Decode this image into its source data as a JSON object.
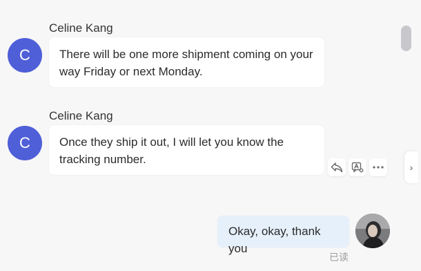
{
  "messages": [
    {
      "sender": "Celine Kang",
      "avatar_letter": "C",
      "text": "There will be one more shipment coming on your way Friday or next Monday."
    },
    {
      "sender": "Celine Kang",
      "avatar_letter": "C",
      "text": "Once they ship it out, I will let you know the tracking number."
    }
  ],
  "my_message": {
    "text": "Okay, okay, thank you",
    "read_status": "已读"
  },
  "actions": [
    {
      "icon": "reply-icon"
    },
    {
      "icon": "translate-icon"
    },
    {
      "icon": "more-icon"
    }
  ],
  "side_handle_glyph": "›",
  "colors": {
    "avatar": "#4f5fd8",
    "my_bubble": "#e6f0fb",
    "background": "#f7f7f8"
  }
}
